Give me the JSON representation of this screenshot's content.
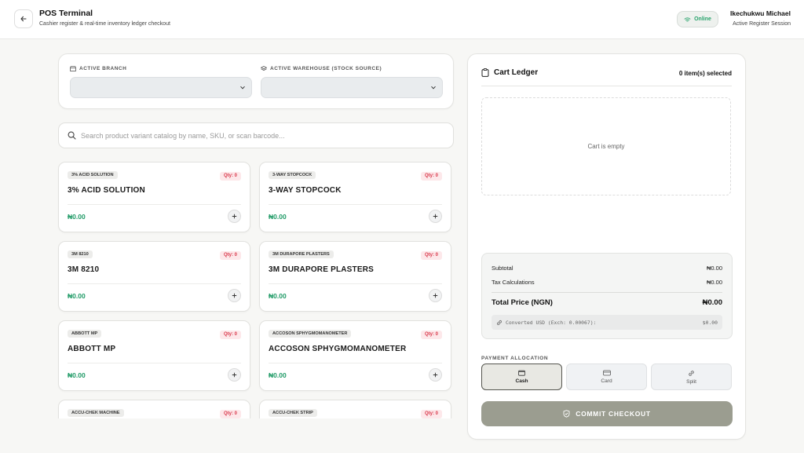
{
  "header": {
    "title": "POS Terminal",
    "subtitle": "Cashier register & real-time inventory ledger checkout",
    "status": "Online",
    "user_name": "Ikechukwu Michael",
    "user_session": "Active Register Session"
  },
  "filters": {
    "branch_label": "ACTIVE BRANCH",
    "branch_value": "",
    "warehouse_label": "ACTIVE WAREHOUSE (STOCK SOURCE)",
    "warehouse_value": ""
  },
  "search": {
    "placeholder": "Search product variant catalog by name, SKU, or scan barcode..."
  },
  "products": [
    {
      "tag": "3% ACID SOLUTION",
      "name": "3% ACID SOLUTION",
      "qty": "Qty: 0",
      "price": "₦0.00"
    },
    {
      "tag": "3-WAY STOPCOCK",
      "name": "3-WAY STOPCOCK",
      "qty": "Qty: 0",
      "price": "₦0.00"
    },
    {
      "tag": "3M 8210",
      "name": "3M 8210",
      "qty": "Qty: 0",
      "price": "₦0.00"
    },
    {
      "tag": "3M DURAPORE PLASTERS",
      "name": "3M DURAPORE PLASTERS",
      "qty": "Qty: 0",
      "price": "₦0.00"
    },
    {
      "tag": "ABBOTT MP",
      "name": "ABBOTT MP",
      "qty": "Qty: 0",
      "price": "₦0.00"
    },
    {
      "tag": "ACCOSON SPHYGMOMANOMETER",
      "name": "ACCOSON SPHYGMOMANOMETER",
      "qty": "Qty: 0",
      "price": "₦0.00"
    },
    {
      "tag": "ACCU-CHEK MACHINE",
      "name": "",
      "qty": "Qty: 0",
      "price": ""
    },
    {
      "tag": "ACCU-CHEK STRIP",
      "name": "",
      "qty": "Qty: 0",
      "price": ""
    }
  ],
  "cart": {
    "title": "Cart Ledger",
    "count": "0 item(s) selected",
    "empty": "Cart is empty",
    "subtotal_label": "Subtotal",
    "subtotal_value": "₦0.00",
    "tax_label": "Tax Calculations",
    "tax_value": "₦0.00",
    "total_label": "Total Price (NGN)",
    "total_value": "₦0.00",
    "usd_label": "Converted USD (Exch: 0.00067):",
    "usd_value": "$0.00",
    "payment_label": "PAYMENT ALLOCATION",
    "payment_methods": [
      "Cash",
      "Card",
      "Split"
    ],
    "selected_payment": "Cash",
    "commit_label": "COMMIT CHECKOUT"
  },
  "colors": {
    "accent_green": "#1f9a66",
    "qty_red": "#d9374a",
    "commit_button": "#9b9d90"
  }
}
